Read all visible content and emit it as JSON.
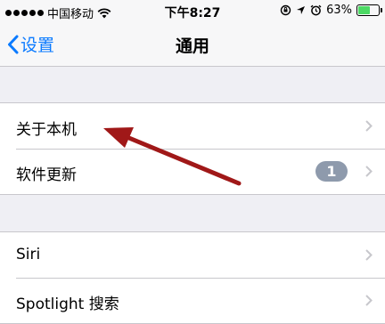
{
  "statusbar": {
    "carrier": "中国移动",
    "time": "下午8:27",
    "battery": "63%",
    "battery_level": 0.63,
    "icons": [
      "signal-dots",
      "wifi-icon",
      "rotation-lock-icon",
      "location-arrow-icon",
      "alarm-icon",
      "battery-icon"
    ]
  },
  "navbar": {
    "back_label": "设置",
    "title": "通用"
  },
  "groups": [
    {
      "rows": [
        {
          "label": "关于本机"
        },
        {
          "label": "软件更新",
          "badge": "1"
        }
      ]
    },
    {
      "rows": [
        {
          "label": "Siri"
        },
        {
          "label": "Spotlight 搜索"
        }
      ]
    }
  ],
  "colors": {
    "accent": "#0a7aff",
    "background": "#efeff4",
    "badge": "#8e9aac",
    "annotation_arrow": "#a01818"
  }
}
